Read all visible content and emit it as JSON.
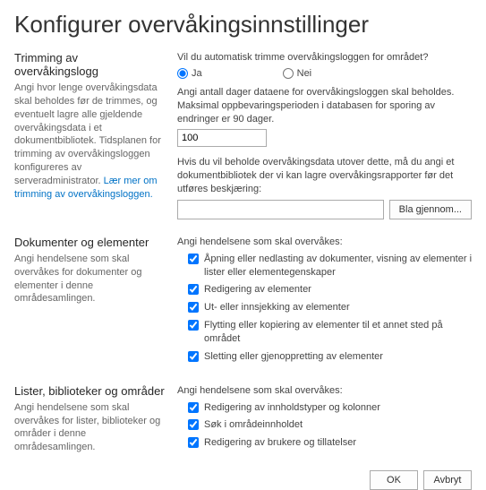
{
  "title": "Konfigurer overvåkingsinnstillinger",
  "trimming": {
    "heading": "Trimming av overvåkingslogg",
    "desc": "Angi hvor lenge overvåkingsdata skal beholdes før de trimmes, og eventuelt lagre alle gjeldende overvåkingsdata i et dokumentbibliotek. Tidsplanen for trimming av overvåkingsloggen konfigureres av serveradministrator. ",
    "link": "Lær mer om trimming av overvåkingsloggen.",
    "q_auto": "Vil du automatisk trimme overvåkingsloggen for området?",
    "yes": "Ja",
    "no": "Nei",
    "q_days": "Angi antall dager dataene for overvåkingsloggen skal beholdes. Maksimal oppbevaringsperioden i databasen for sporing av endringer er 90 dager.",
    "days_value": "100",
    "q_lib": "Hvis du vil beholde overvåkingsdata utover dette, må du angi et dokumentbibliotek der vi kan lagre overvåkingsrapporter før det utføres beskjæring:",
    "lib_value": "",
    "browse": "Bla gjennom..."
  },
  "documents": {
    "heading": "Dokumenter og elementer",
    "desc": "Angi hendelsene som skal overvåkes for dokumenter og elementer i denne områdesamlingen.",
    "prompt": "Angi hendelsene som skal overvåkes:",
    "items": [
      "Åpning eller nedlasting av dokumenter, visning av elementer i lister eller elementegenskaper",
      "Redigering av elementer",
      "Ut- eller innsjekking av elementer",
      "Flytting eller kopiering av elementer til et annet sted på området",
      "Sletting eller gjenoppretting av elementer"
    ]
  },
  "lists": {
    "heading": "Lister, biblioteker og områder",
    "desc": "Angi hendelsene som skal overvåkes for lister, biblioteker og områder i denne områdesamlingen.",
    "prompt": "Angi hendelsene som skal overvåkes:",
    "items": [
      "Redigering av innholdstyper og kolonner",
      "Søk i områdeinnholdet",
      "Redigering av brukere og tillatelser"
    ]
  },
  "buttons": {
    "ok": "OK",
    "cancel": "Avbryt"
  }
}
